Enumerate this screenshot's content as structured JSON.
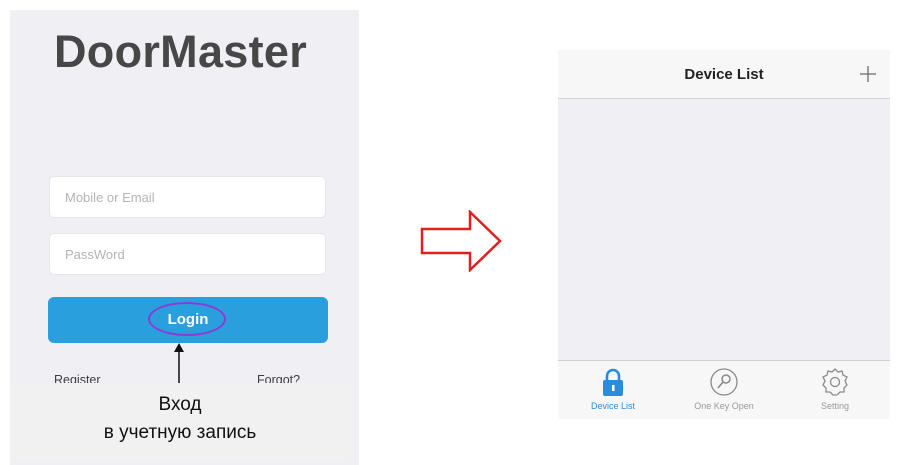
{
  "login": {
    "logo": "DoorMaster",
    "email_placeholder": "Mobile or Email",
    "password_placeholder": "PassWord",
    "login_label": "Login",
    "register_label": "Register",
    "forgot_label": "Forgot?"
  },
  "caption": {
    "line1": "Вход",
    "line2": "в учетную запись"
  },
  "device_screen": {
    "title": "Device List",
    "tabs": [
      {
        "label": "Device List",
        "icon": "lock-icon",
        "active": true
      },
      {
        "label": "One Key Open",
        "icon": "key-icon",
        "active": false
      },
      {
        "label": "Setting",
        "icon": "gear-icon",
        "active": false
      }
    ]
  },
  "colors": {
    "accent": "#2a9fde",
    "highlight_oval": "#8e3ad6",
    "transition_arrow": "#e02020",
    "background": "#efeff4"
  }
}
